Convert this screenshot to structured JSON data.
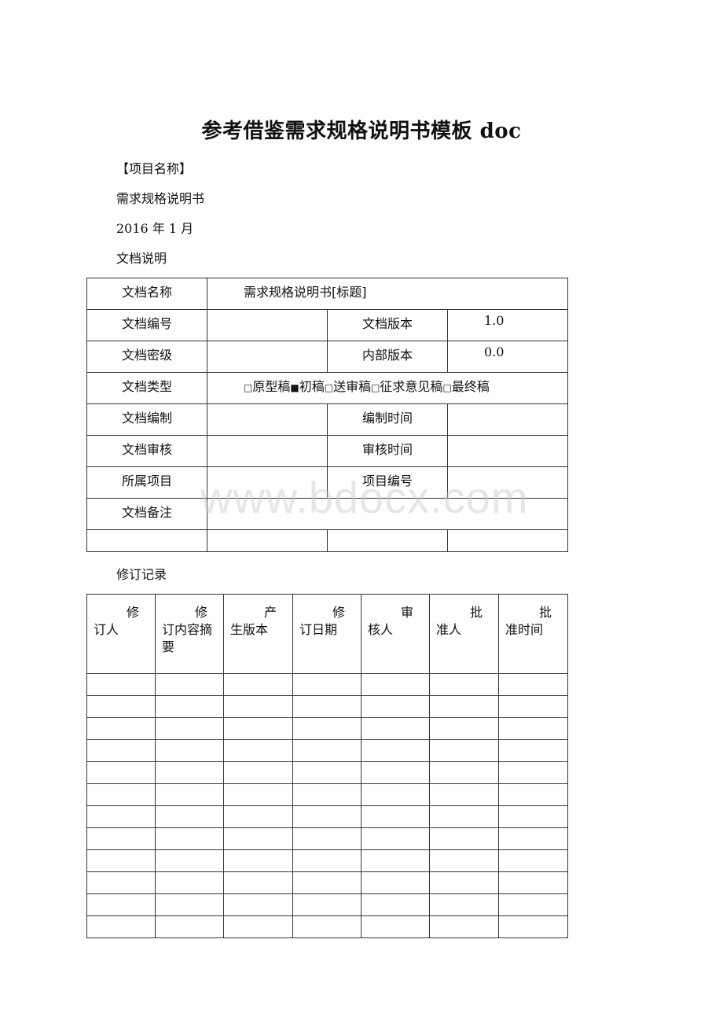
{
  "document": {
    "title": "参考借鉴需求规格说明书模板 doc",
    "project_name_placeholder": "【项目名称】",
    "subtitle": "需求规格说明书",
    "date": "2016 年 1 月",
    "doc_info_heading": "文档说明",
    "revision_heading": "修订记录",
    "watermark": "www.bdocx.com"
  },
  "info_table": {
    "doc_name_label": "文档名称",
    "doc_name_value": "需求规格说明书[标题]",
    "doc_number_label": "文档编号",
    "doc_number_value": "",
    "doc_version_label": "文档版本",
    "doc_version_value": "1.0",
    "security_label": "文档密级",
    "security_value": "",
    "internal_version_label": "内部版本",
    "internal_version_value": "0.0",
    "doc_type_label": "文档类型",
    "doc_type_options": [
      {
        "label": "原型稿",
        "checked": false
      },
      {
        "label": "初稿",
        "checked": true
      },
      {
        "label": "送审稿",
        "checked": false
      },
      {
        "label": "征求意见稿",
        "checked": false
      },
      {
        "label": "最终稿",
        "checked": false
      }
    ],
    "author_label": "文档编制",
    "author_value": "",
    "author_time_label": "编制时间",
    "author_time_value": "",
    "reviewer_label": "文档审核",
    "reviewer_value": "",
    "review_time_label": "审核时间",
    "review_time_value": "",
    "project_label": "所属项目",
    "project_value": "",
    "project_number_label": "项目编号",
    "project_number_value": "",
    "remarks_label": "文档备注",
    "remarks_value": ""
  },
  "revision_table": {
    "headers": [
      {
        "first": "修",
        "rest": "订人"
      },
      {
        "first": "修",
        "rest": "订内容摘要"
      },
      {
        "first": "产",
        "rest": "生版本"
      },
      {
        "first": "修",
        "rest": "订日期"
      },
      {
        "first": "审",
        "rest": "核人"
      },
      {
        "first": "批",
        "rest": "准人"
      },
      {
        "first": "批",
        "rest": "准时间"
      }
    ],
    "rows": [
      [
        "",
        "",
        "",
        "",
        "",
        "",
        ""
      ],
      [
        "",
        "",
        "",
        "",
        "",
        "",
        ""
      ],
      [
        "",
        "",
        "",
        "",
        "",
        "",
        ""
      ],
      [
        "",
        "",
        "",
        "",
        "",
        "",
        ""
      ],
      [
        "",
        "",
        "",
        "",
        "",
        "",
        ""
      ],
      [
        "",
        "",
        "",
        "",
        "",
        "",
        ""
      ],
      [
        "",
        "",
        "",
        "",
        "",
        "",
        ""
      ],
      [
        "",
        "",
        "",
        "",
        "",
        "",
        ""
      ],
      [
        "",
        "",
        "",
        "",
        "",
        "",
        ""
      ],
      [
        "",
        "",
        "",
        "",
        "",
        "",
        ""
      ],
      [
        "",
        "",
        "",
        "",
        "",
        "",
        ""
      ],
      [
        "",
        "",
        "",
        "",
        "",
        "",
        ""
      ]
    ]
  },
  "icons": {
    "checkbox_unchecked": "□",
    "checkbox_checked": "■"
  }
}
